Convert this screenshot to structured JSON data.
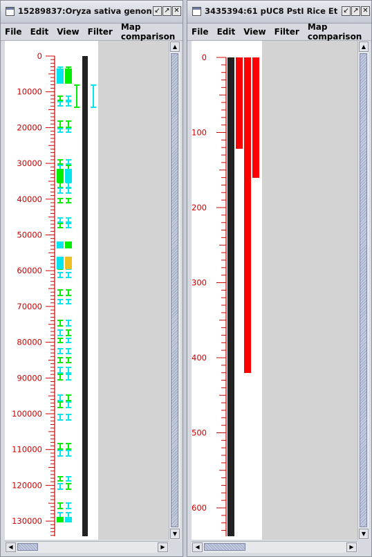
{
  "window1": {
    "title": "15289837:Oryza sativa genon",
    "menu": [
      "File",
      "Edit",
      "View",
      "Filter",
      "Map comparison"
    ],
    "axis_labels": [
      "0",
      "10000",
      "20000",
      "30000",
      "40000",
      "50000",
      "60000",
      "70000",
      "80000",
      "90000",
      "100000",
      "110000",
      "120000",
      "130000"
    ],
    "axis_color": "#cc0000",
    "feature_colors": {
      "cyan": "#00e5ee",
      "green": "#00ee00",
      "yellow": "#f0c020",
      "dark": "#222222"
    }
  },
  "window2": {
    "title": "3435394:61 pUC8 PstI Rice Et",
    "menu": [
      "File",
      "Edit",
      "View",
      "Filter",
      "Map comparison"
    ],
    "axis_labels": [
      "0",
      "100",
      "200",
      "300",
      "400",
      "500",
      "600"
    ],
    "axis_color": "#cc0000",
    "feature_colors": {
      "red": "#ff0000",
      "dark": "#222222"
    }
  },
  "title_buttons": [
    "↙",
    "↗",
    "✕"
  ]
}
